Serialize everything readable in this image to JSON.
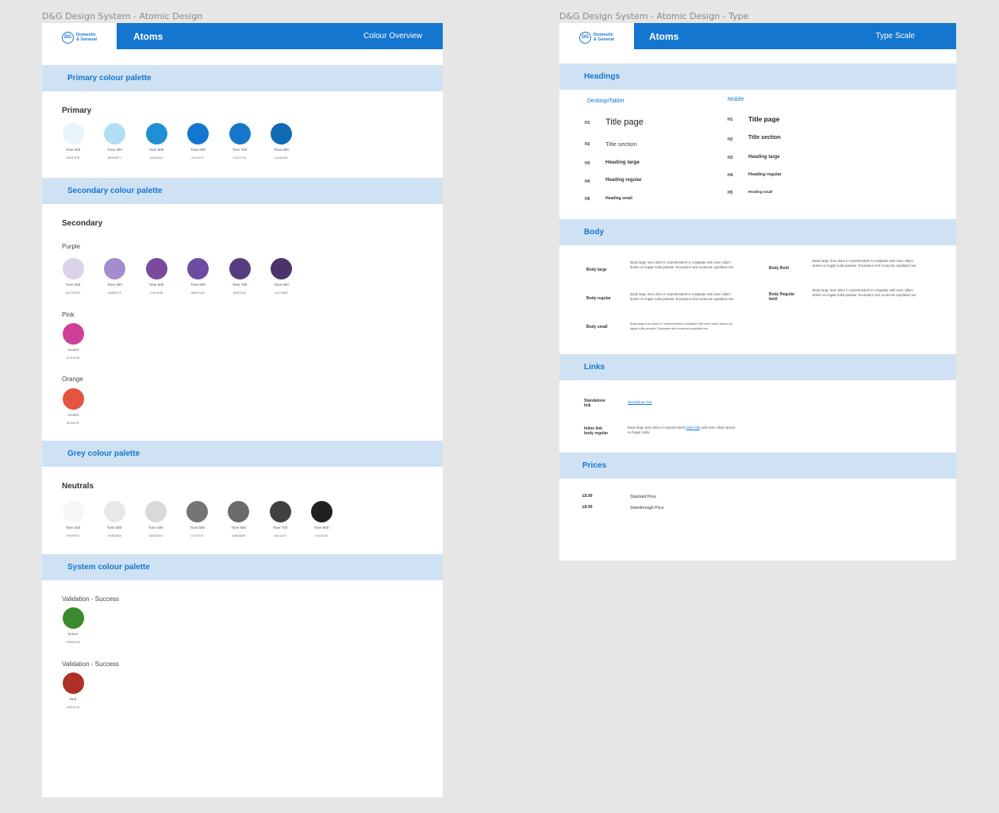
{
  "left_frame_title": "D&G Design System - Atomic Design",
  "right_frame_title": "D&G Design System - Atomic Design - Type",
  "logo_text_line1": "Domestic",
  "logo_text_line2": "& General",
  "logo_mark": "DG",
  "atoms_label": "Atoms",
  "colour_overview_label": "Colour Overview",
  "type_scale_label": "Type Scale",
  "primary": {
    "band": "Primary colour palette",
    "heading": "Primary",
    "swatches": [
      {
        "label": "Tone 300",
        "hex": "#E6F4FB",
        "color": "#e6f4fb"
      },
      {
        "label": "Tone 400",
        "hex": "#B2DEF1",
        "color": "#b2def1"
      },
      {
        "label": "Tone 500",
        "hex": "#1E90D3",
        "color": "#1e90d3"
      },
      {
        "label": "Tone 600",
        "hex": "#1576CF",
        "color": "#1576cf"
      },
      {
        "label": "Tone 700",
        "hex": "#1677C8",
        "color": "#1677c8"
      },
      {
        "label": "Tone 800",
        "hex": "#106AB4",
        "color": "#106ab4"
      }
    ]
  },
  "secondary": {
    "band": "Secondary colour palette",
    "heading": "Secondary",
    "purple_label": "Purple",
    "purple": [
      {
        "label": "Tone 300",
        "hex": "#DCD2EA",
        "color": "#dcd2ea"
      },
      {
        "label": "Tone 400",
        "hex": "#A58CCF",
        "color": "#a58ccf"
      },
      {
        "label": "Tone 500",
        "hex": "#7A4A9B",
        "color": "#7a4a9b"
      },
      {
        "label": "Tone 600",
        "hex": "#6E4CA2",
        "color": "#6e4ca2"
      },
      {
        "label": "Tone 700",
        "hex": "#583C80",
        "color": "#583c80"
      },
      {
        "label": "Tone 800",
        "hex": "#4C3468",
        "color": "#4c3468"
      }
    ],
    "pink_label": "Pink",
    "pink": {
      "label": "Accent",
      "hex": "#CE3F98",
      "color": "#ce3f98"
    },
    "orange_label": "Orange",
    "orange": {
      "label": "Accent",
      "hex": "#E5543F",
      "color": "#e5543f"
    }
  },
  "grey": {
    "band": "Grey colour palette",
    "heading": "Neutrals",
    "swatches": [
      {
        "label": "Tone 200",
        "hex": "#F6F6F6",
        "color": "#f6f6f6"
      },
      {
        "label": "Tone 300",
        "hex": "#E8E8E8",
        "color": "#e8e8e8"
      },
      {
        "label": "Tone 400",
        "hex": "#D9D9D9",
        "color": "#d9d9d9"
      },
      {
        "label": "Tone 500",
        "hex": "#757575",
        "color": "#757575"
      },
      {
        "label": "Tone 600",
        "hex": "#6B6B6B",
        "color": "#6b6b6b"
      },
      {
        "label": "Tone 700",
        "hex": "#414141",
        "color": "#414141"
      },
      {
        "label": "Tone 800",
        "hex": "#202020",
        "color": "#202020"
      }
    ]
  },
  "system": {
    "band": "System colour palette",
    "success_label": "Validation - Success",
    "green": {
      "label": "Green",
      "hex": "#3B8A2B",
      "color": "#3b8a2b"
    },
    "error_label": "Validation - Success",
    "red": {
      "label": "Red",
      "hex": "#AE3128",
      "color": "#ae3128"
    }
  },
  "headings": {
    "band": "Headings",
    "desktop_label": "Desktop/Tablet",
    "mobile_label": "Mobile",
    "desktop": [
      {
        "tag": "H1",
        "text": "Title page"
      },
      {
        "tag": "H2",
        "text": "Title section"
      },
      {
        "tag": "H3",
        "text": "Heading large"
      },
      {
        "tag": "H4",
        "text": "Heading regular"
      },
      {
        "tag": "H5",
        "text": "Heading small"
      }
    ],
    "mobile": [
      {
        "tag": "H1",
        "text": "Title page"
      },
      {
        "tag": "H2",
        "text": "Title section"
      },
      {
        "tag": "H3",
        "text": "Heading large"
      },
      {
        "tag": "H4",
        "text": "Heading regular"
      },
      {
        "tag": "H5",
        "text": "Heading small"
      }
    ]
  },
  "body": {
    "band": "Body",
    "large_label": "Body large",
    "large_text": "Body large irure dolor in reprehenderit in voluptate velit esse cillum dolore eu fugiat nulla pariatur. Excepteur sint occaecat cupidatat non.",
    "regular_label": "Body regular",
    "regular_text": "Body large irure dolor in reprehenderit in voluptate velit esse cillum dolore eu fugiat nulla pariatur. Excepteur sint occaecat cupidatat non.",
    "small_label": "Body small",
    "small_text": "Body large irure dolor in reprehenderit in voluptate velit esse cillum dolore eu fugiat nulla pariatur. Excepteur sint occaecat cupidatat non.",
    "bold_label": "Body Bold",
    "bold_text": "Body large irure dolor in reprehenderit in voluptate velit esse cillum dolore eu fugiat nulla pariatur. Excepteur sint occaecat cupidatat non.",
    "regular_bold_label": "Body Regular bold",
    "regular_bold_text": "Body large irure dolor in reprehenderit in voluptate velit esse cillum dolore eu fugiat nulla pariatur. Excepteur sint occaecat cupidatat non."
  },
  "links": {
    "band": "Links",
    "standalone_label": "Standalone link",
    "standalone_link": "Standalone link",
    "inline_label": "Inline link body regular",
    "inline_before": "Body large irure dolor in reprehenderit",
    "inline_link": "inline link",
    "inline_after": "velit esse cillum dolore eu fugiat nulla."
  },
  "prices": {
    "band": "Prices",
    "items": [
      {
        "value": "£8.99",
        "label": "Standard Price"
      },
      {
        "value": "£8.99",
        "label": "Strikethrough Price"
      }
    ]
  }
}
